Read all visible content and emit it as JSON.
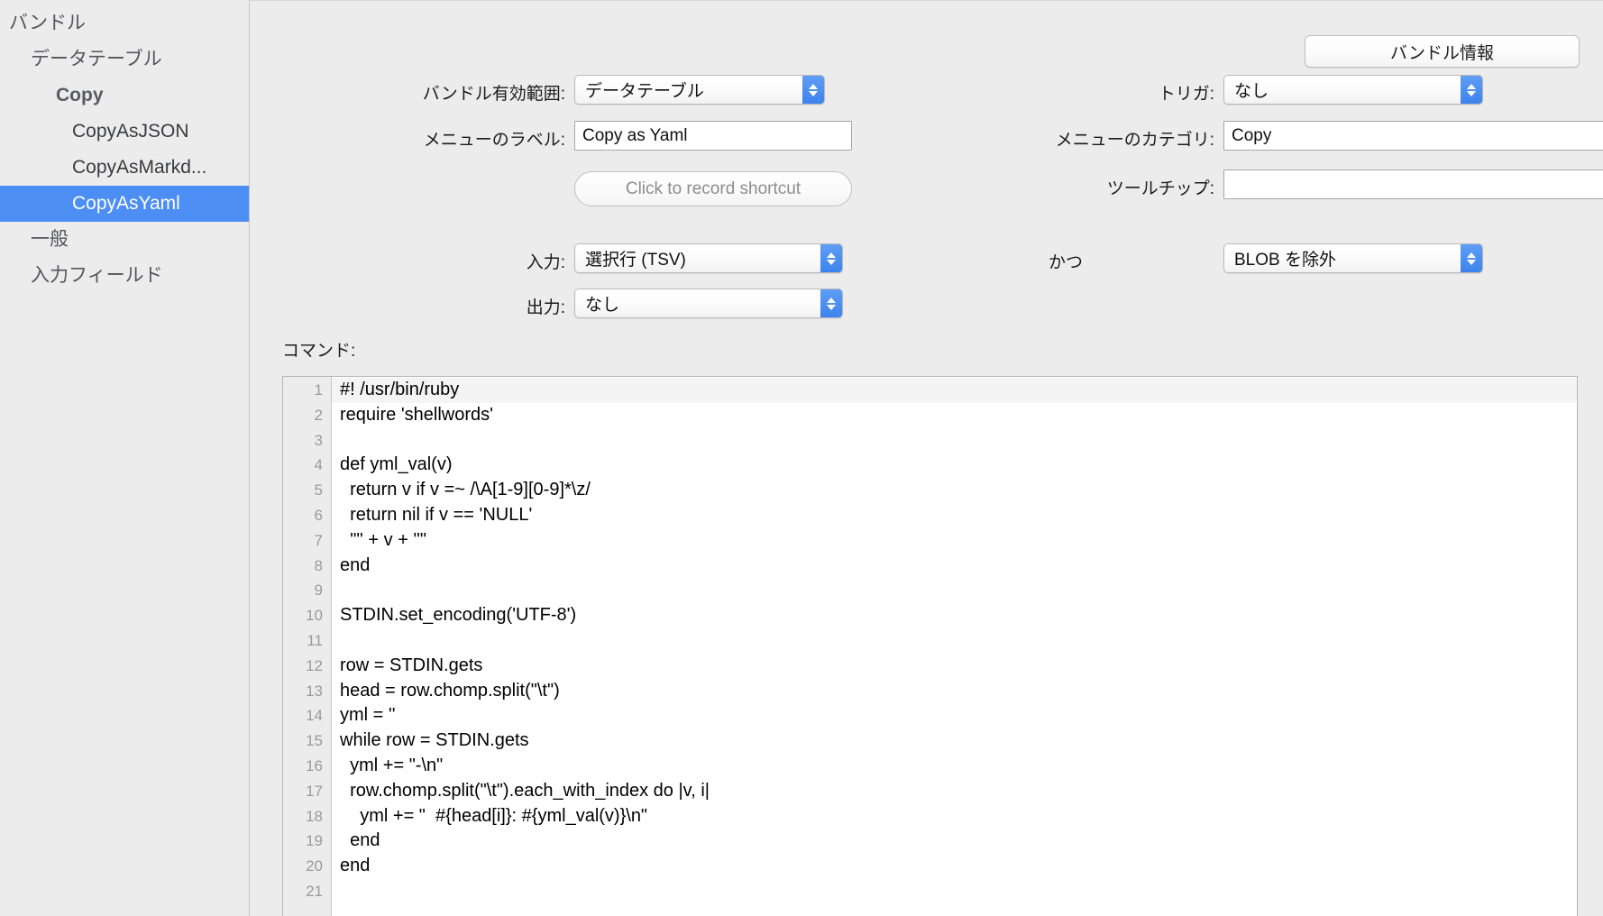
{
  "sidebar": {
    "items": [
      {
        "label": "バンドル",
        "level": 0,
        "selected": false
      },
      {
        "label": "データテーブル",
        "level": 1,
        "selected": false
      },
      {
        "label": "Copy",
        "level": 2,
        "selected": false
      },
      {
        "label": "CopyAsJSON",
        "level": 3,
        "selected": false
      },
      {
        "label": "CopyAsMarkd...",
        "level": 3,
        "selected": false
      },
      {
        "label": "CopyAsYaml",
        "level": 3,
        "selected": true
      },
      {
        "label": "一般",
        "level": 1,
        "selected": false
      },
      {
        "label": "入力フィールド",
        "level": 1,
        "selected": false
      }
    ],
    "selection_color": "#4d8ef5"
  },
  "toolbar": {
    "bundle_info_label": "バンドル情報"
  },
  "form": {
    "scope": {
      "label": "バンドル有効範囲:",
      "value": "データテーブル"
    },
    "menu_label": {
      "label": "メニューのラベル:",
      "value": "Copy as Yaml"
    },
    "shortcut": {
      "placeholder": "Click to record shortcut"
    },
    "trigger": {
      "label": "トリガ:",
      "value": "なし"
    },
    "menu_category": {
      "label": "メニューのカテゴリ:",
      "value": "Copy"
    },
    "tooltip": {
      "label": "ツールチップ:",
      "value": ""
    },
    "input": {
      "label": "入力:",
      "value": "選択行 (TSV)"
    },
    "output": {
      "label": "出力:",
      "value": "なし"
    },
    "and": {
      "label": "かつ",
      "value": "BLOB を除外"
    }
  },
  "command": {
    "label": "コマンド:",
    "current_line": 1,
    "lines": [
      {
        "n": "1",
        "text": "#! /usr/bin/ruby"
      },
      {
        "n": "2",
        "text": "require 'shellwords'"
      },
      {
        "n": "3",
        "text": ""
      },
      {
        "n": "4",
        "text": "def yml_val(v)"
      },
      {
        "n": "5",
        "text": "  return v if v =~ /\\A[1-9][0-9]*\\z/"
      },
      {
        "n": "6",
        "text": "  return nil if v == 'NULL'"
      },
      {
        "n": "7",
        "text": "  '\"' + v + '\"'"
      },
      {
        "n": "8",
        "text": "end"
      },
      {
        "n": "9",
        "text": ""
      },
      {
        "n": "10",
        "text": "STDIN.set_encoding('UTF-8')"
      },
      {
        "n": "11",
        "text": ""
      },
      {
        "n": "12",
        "text": "row = STDIN.gets"
      },
      {
        "n": "13",
        "text": "head = row.chomp.split(\"\\t\")"
      },
      {
        "n": "14",
        "text": "yml = ''"
      },
      {
        "n": "15",
        "text": "while row = STDIN.gets"
      },
      {
        "n": "16",
        "text": "  yml += \"-\\n\""
      },
      {
        "n": "17",
        "text": "  row.chomp.split(\"\\t\").each_with_index do |v, i|"
      },
      {
        "n": "18",
        "text": "    yml += \"  #{head[i]}: #{yml_val(v)}\\n\""
      },
      {
        "n": "19",
        "text": "  end"
      },
      {
        "n": "20",
        "text": "end"
      },
      {
        "n": "21",
        "text": ""
      }
    ]
  }
}
